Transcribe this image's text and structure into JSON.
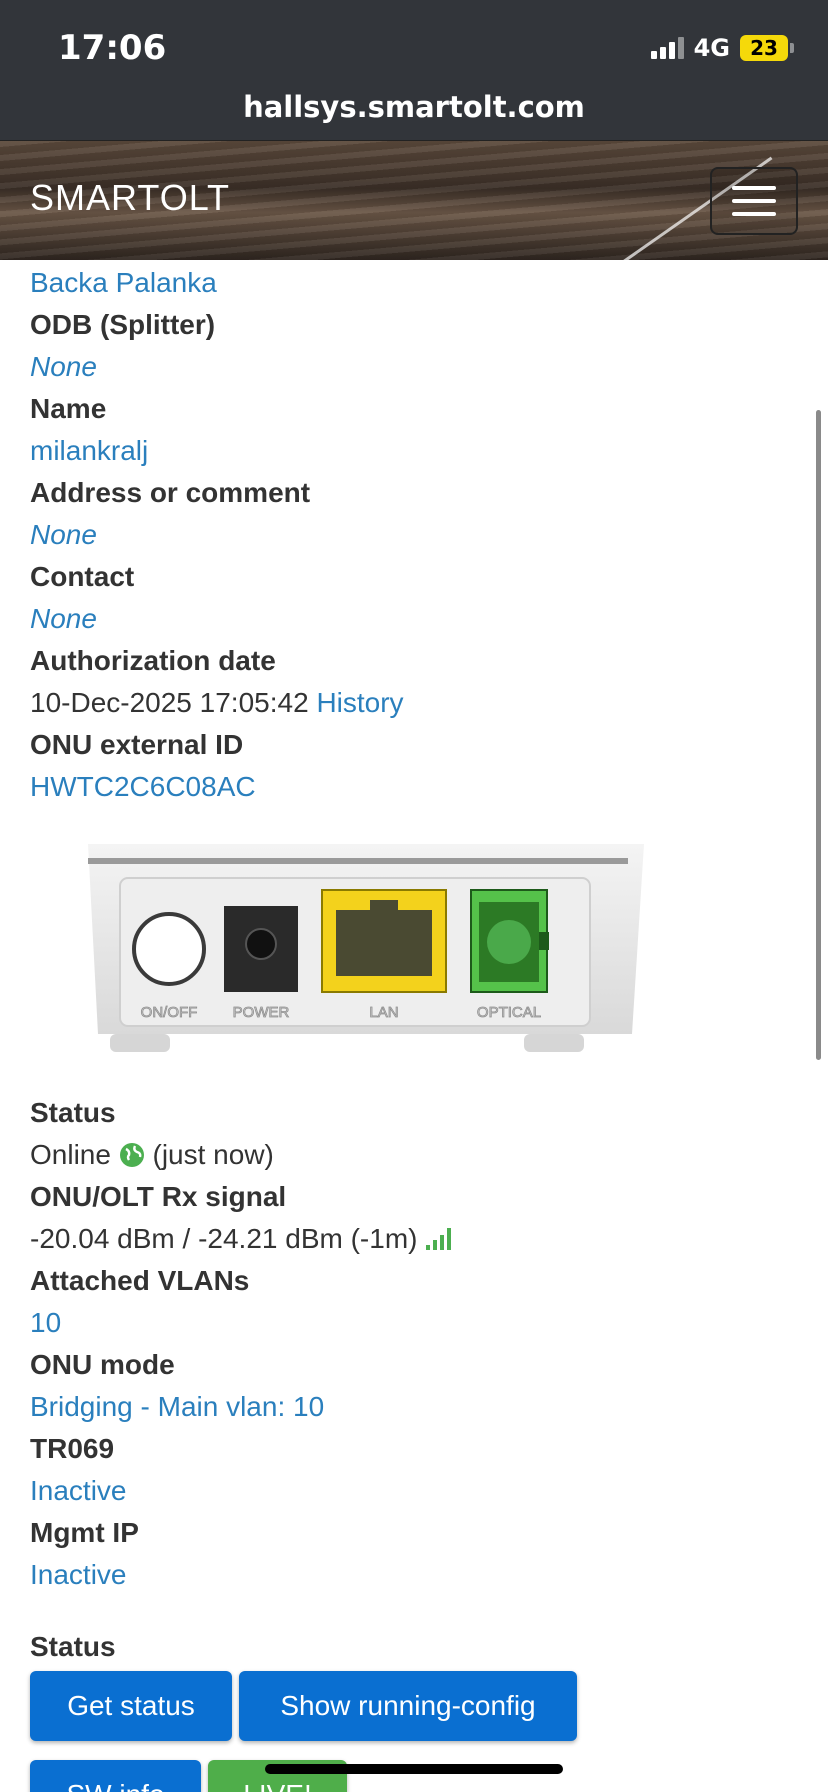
{
  "status_bar": {
    "time": "17:06",
    "network": "4G",
    "battery": "23"
  },
  "browser": {
    "url": "hallsys.smartolt.com"
  },
  "navbar": {
    "brand": "SMARTOLT"
  },
  "details": {
    "zone_value": "Backa Palanka",
    "odb_label": "ODB (Splitter)",
    "odb_value": "None",
    "name_label": "Name",
    "name_value": "milankralj",
    "address_label": "Address or comment",
    "address_value": "None",
    "contact_label": "Contact",
    "contact_value": "None",
    "auth_label": "Authorization date",
    "auth_value": "10-Dec-2025 17:05:42",
    "auth_history": "History",
    "extid_label": "ONU external ID",
    "extid_value": "HWTC2C6C08AC"
  },
  "device": {
    "port_labels": [
      "ON/OFF",
      "POWER",
      "LAN",
      "OPTICAL"
    ]
  },
  "status": {
    "status_label": "Status",
    "status_value": "Online",
    "status_time": "(just now)",
    "signal_label": "ONU/OLT Rx signal",
    "signal_value": "-20.04 dBm / -24.21 dBm (-1m)",
    "vlans_label": "Attached VLANs",
    "vlans_value": "10",
    "mode_label": "ONU mode",
    "mode_value": "Bridging - Main vlan: 10",
    "tr069_label": "TR069",
    "tr069_value": "Inactive",
    "mgmt_label": "Mgmt IP",
    "mgmt_value": "Inactive"
  },
  "actions": {
    "section_label": "Status",
    "get_status": "Get status",
    "running_config": "Show running-config",
    "sw_info": "SW info",
    "live": "LIVE!"
  },
  "colors": {
    "link": "#2a7fbd",
    "primary_button": "#0a6fd1",
    "success_button": "#4fae4a",
    "status_bar": "#32353a"
  }
}
